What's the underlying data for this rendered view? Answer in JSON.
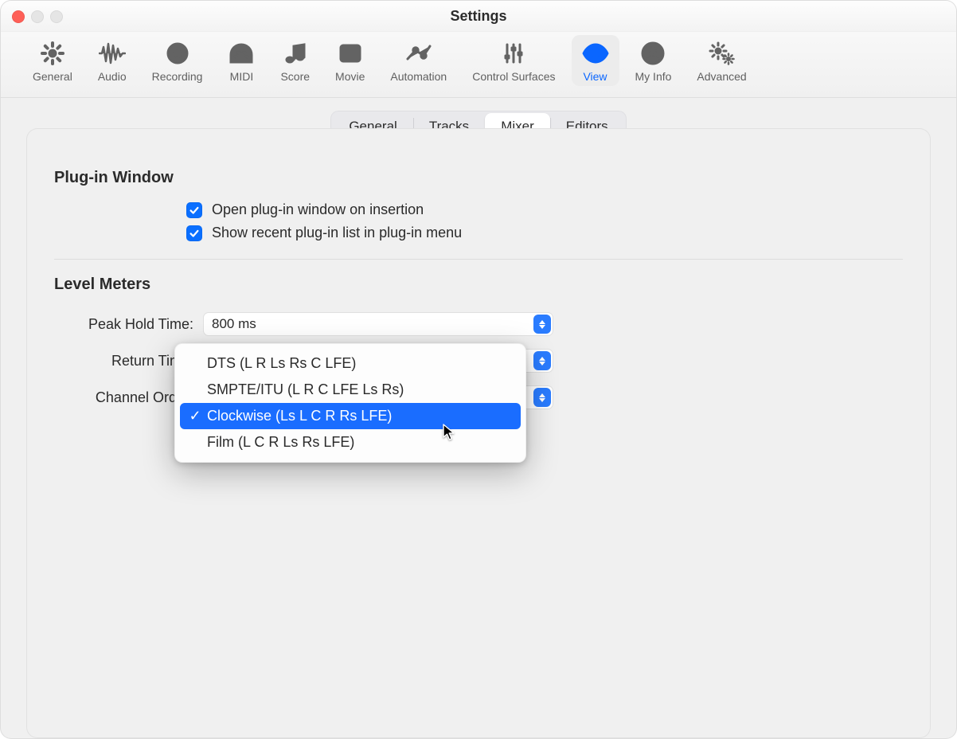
{
  "window": {
    "title": "Settings"
  },
  "toolbar": [
    {
      "id": "general",
      "label": "General"
    },
    {
      "id": "audio",
      "label": "Audio"
    },
    {
      "id": "recording",
      "label": "Recording"
    },
    {
      "id": "midi",
      "label": "MIDI"
    },
    {
      "id": "score",
      "label": "Score"
    },
    {
      "id": "movie",
      "label": "Movie"
    },
    {
      "id": "automation",
      "label": "Automation"
    },
    {
      "id": "control-surfaces",
      "label": "Control Surfaces"
    },
    {
      "id": "view",
      "label": "View",
      "active": true
    },
    {
      "id": "my-info",
      "label": "My Info"
    },
    {
      "id": "advanced",
      "label": "Advanced"
    }
  ],
  "subtabs": {
    "items": [
      "General",
      "Tracks",
      "Mixer",
      "Editors"
    ],
    "selected": "Mixer"
  },
  "sections": {
    "plugin_window": {
      "title": "Plug-in Window",
      "rows": [
        {
          "checked": true,
          "label": "Open plug-in window on insertion"
        },
        {
          "checked": true,
          "label": "Show recent plug-in list in plug-in menu"
        }
      ]
    },
    "level_meters": {
      "title": "Level Meters",
      "fields": [
        {
          "label": "Peak Hold Time:",
          "value": "800 ms"
        },
        {
          "label": "Return Time:",
          "value": ""
        },
        {
          "label": "Channel Order:",
          "value": ""
        }
      ]
    }
  },
  "channel_order_menu": {
    "open": true,
    "highlight_index": 2,
    "items": [
      "DTS (L R Ls Rs C LFE)",
      "SMPTE/ITU (L R C LFE Ls Rs)",
      "Clockwise (Ls L C R Rs LFE)",
      "Film (L C R Ls Rs LFE)"
    ]
  }
}
